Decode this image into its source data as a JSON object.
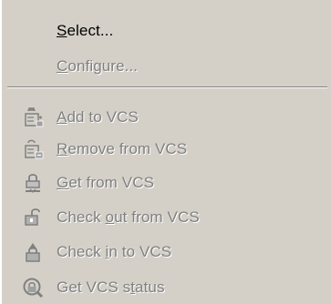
{
  "menu": {
    "items_top": [
      {
        "pre": "",
        "acc": "S",
        "post": "elect...",
        "enabled": true
      },
      {
        "pre": "",
        "acc": "C",
        "post": "onfigure...",
        "enabled": false
      }
    ],
    "items_vcs": [
      {
        "pre": "",
        "acc": "A",
        "post": "dd to VCS",
        "icon": "add-to-vcs-icon",
        "enabled": false
      },
      {
        "pre": "",
        "acc": "R",
        "post": "emove from VCS",
        "icon": "remove-from-vcs-icon",
        "enabled": false
      },
      {
        "pre": "",
        "acc": "G",
        "post": "et from VCS",
        "icon": "get-from-vcs-icon",
        "enabled": false
      },
      {
        "pre": "Check ",
        "acc": "o",
        "post": "ut from VCS",
        "icon": "check-out-icon",
        "enabled": false
      },
      {
        "pre": "Check ",
        "acc": "i",
        "post": "n to VCS",
        "icon": "check-in-icon",
        "enabled": false
      },
      {
        "pre": "Get VCS s",
        "acc": "t",
        "post": "atus",
        "icon": "vcs-status-icon",
        "enabled": false
      }
    ]
  }
}
